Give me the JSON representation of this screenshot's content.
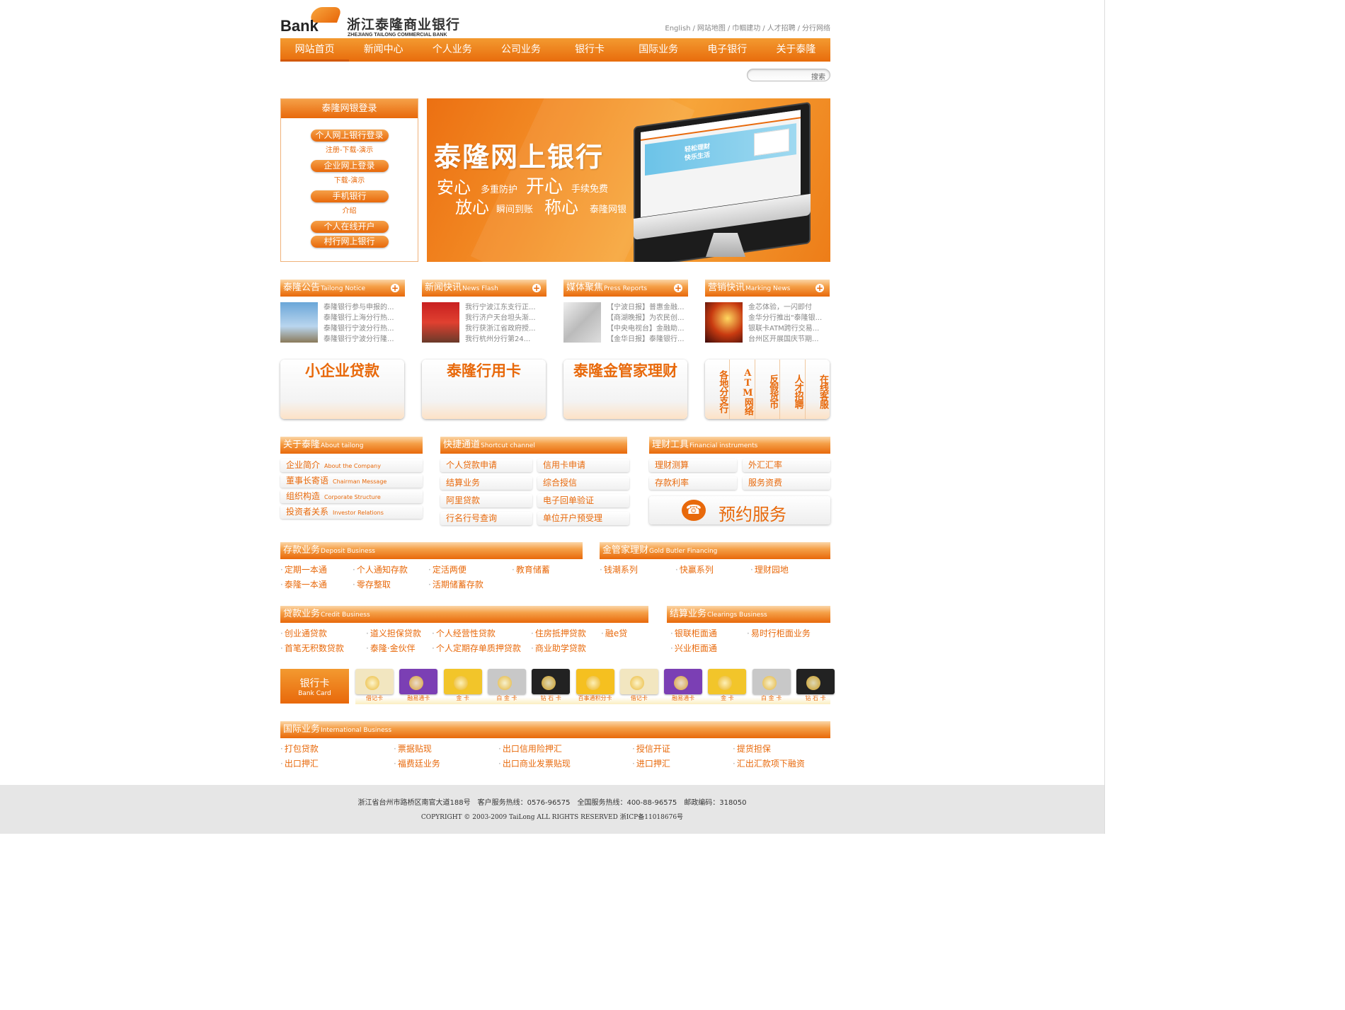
{
  "logo": {
    "bank": "Bank",
    "cn": "浙江泰隆商业银行",
    "en": "ZHEJIANG TAILONG COMMERCIAL BANK"
  },
  "toplinks": [
    "English",
    "网站地图",
    "巾帼建功",
    "人才招聘",
    "分行网络"
  ],
  "nav": [
    "网站首页",
    "新闻中心",
    "个人业务",
    "公司业务",
    "银行卡",
    "国际业务",
    "电子银行",
    "关于泰隆"
  ],
  "search": {
    "placeholder": "",
    "button": "搜索"
  },
  "login": {
    "title": "泰隆网银登录",
    "items": [
      {
        "btn": "个人网上银行登录",
        "sub": "注册-下载-演示"
      },
      {
        "btn": "企业网上登录",
        "sub": "下载-演示"
      },
      {
        "btn": "手机银行",
        "sub": "介绍"
      },
      {
        "btn": "个人在线开户",
        "sub": ""
      },
      {
        "btn": "村行网上银行",
        "sub": ""
      }
    ]
  },
  "banner": {
    "title": "泰隆网上银行",
    "w1": "安心",
    "s1": "多重防护",
    "w2": "开心",
    "s2": "手续免费",
    "w3": "放心",
    "s3": "瞬间到账",
    "w4": "称心",
    "s4": "泰隆网银",
    "screen_text": "轻松理财 快乐生活"
  },
  "news": [
    {
      "title": "泰隆公告",
      "en": "Tailong Notice",
      "items": [
        "泰隆银行参与申报的...",
        "泰隆银行上海分行热...",
        "泰隆银行宁波分行热...",
        "泰隆银行宁波分行隆..."
      ]
    },
    {
      "title": "新闻快讯",
      "en": "News Flash",
      "items": [
        "我行宁波江东支行正...",
        "我行济户天台坦头渐...",
        "我行获浙江省政府授...",
        "我行杭州分行第24..."
      ]
    },
    {
      "title": "媒体聚焦",
      "en": "Press Reports",
      "items": [
        "【宁波日报】普惠金融...",
        "【商湖晚报】为农民创...",
        "【中央电视台】金融助...",
        "【金华日报】泰隆银行..."
      ]
    },
    {
      "title": "营销快讯",
      "en": "Marking News",
      "items": [
        "金芯体验，一闪即付",
        "金华分行推出\"泰隆银...",
        "银联卡ATM跨行交易...",
        "台州区开展国庆节期..."
      ]
    }
  ],
  "promos": [
    "小企业贷款",
    "泰隆行用卡",
    "泰隆金管家理财"
  ],
  "vtabs": [
    "各地分支行",
    "ATM网络",
    "反假货币",
    "人才招聘",
    "在线客服"
  ],
  "about": {
    "title": "关于泰隆",
    "en": "About tailong",
    "items": [
      {
        "cn": "企业简介",
        "en": "About the Company"
      },
      {
        "cn": "董事长寄语",
        "en": "Chairman Message"
      },
      {
        "cn": "组织构造",
        "en": "Corporate Structure"
      },
      {
        "cn": "投资者关系",
        "en": "Investor Relations"
      }
    ]
  },
  "shortcut": {
    "title": "快捷通道",
    "en": "Shortcut channel",
    "items": [
      "个人贷款申请",
      "信用卡申请",
      "结算业务",
      "综合授信",
      "阿里贷款",
      "电子回单验证",
      "行名行号查询",
      "单位开户预受理"
    ]
  },
  "fin": {
    "title": "理财工具",
    "en": "Financial instruments",
    "items": [
      "理财测算",
      "外汇汇率",
      "存款利率",
      "服务资费"
    ],
    "reserve": "预约服务"
  },
  "deposit": {
    "title": "存款业务",
    "en": "Deposit Business",
    "items": [
      "定期一本通",
      "个人通知存款",
      "定活两便",
      "教育储蓄",
      "泰隆一本通",
      "零存整取",
      "活期储蓄存款"
    ]
  },
  "gold": {
    "title": "金管家理财",
    "en": "Gold Butler Financing",
    "items": [
      "钱潮系列",
      "快赢系列",
      "理财园地"
    ]
  },
  "credit": {
    "title": "贷款业务",
    "en": "Credit Business",
    "items": [
      "创业通贷款",
      "道义担保贷款",
      "个人经营性贷款",
      "住房抵押贷款",
      "融e贷",
      "首笔无积数贷款",
      "泰隆·金伙伴",
      "个人定期存单质押贷款",
      "商业助学贷款"
    ]
  },
  "clearing": {
    "title": "结算业务",
    "en": "Clearings Business",
    "items": [
      "银联柜面通",
      "易时行柜面业务",
      "兴业柜面通"
    ]
  },
  "cards": {
    "title": "银行卡",
    "en": "Bank Card",
    "items": [
      {
        "label": "借记卡",
        "color": "#f2e6c0"
      },
      {
        "label": "融易通卡",
        "color": "#7b3fb4"
      },
      {
        "label": "金 卡",
        "color": "#f2c52a"
      },
      {
        "label": "白 金 卡",
        "color": "#c8c8c8"
      },
      {
        "label": "钻 石 卡",
        "color": "#222222"
      },
      {
        "label": "百事通积分卡",
        "color": "#f5c020"
      },
      {
        "label": "借记卡",
        "color": "#f2e6c0"
      },
      {
        "label": "融易通卡",
        "color": "#7b3fb4"
      },
      {
        "label": "金 卡",
        "color": "#f2c52a"
      },
      {
        "label": "白 金 卡",
        "color": "#c8c8c8"
      },
      {
        "label": "钻 石 卡",
        "color": "#222222"
      }
    ]
  },
  "intl": {
    "title": "国际业务",
    "en": "International Business",
    "items": [
      "打包贷款",
      "票据贴现",
      "出口信用险押汇",
      "授信开证",
      "提货担保",
      "出口押汇",
      "福费廷业务",
      "出口商业发票贴现",
      "进口押汇",
      "汇出汇款项下融资"
    ]
  },
  "footer": {
    "line1": "浙江省台州市路桥区南官大道188号　客户服务热线：0576-96575　全国服务热线：400-88-96575　邮政编码：318050",
    "line2": "COPYRIGHT © 2003-2009 TaiLong ALL RIGHTS RESERVED 浙ICP备11018676号"
  },
  "colors": {
    "accent": "#e8690b",
    "light": "#f5a048"
  }
}
